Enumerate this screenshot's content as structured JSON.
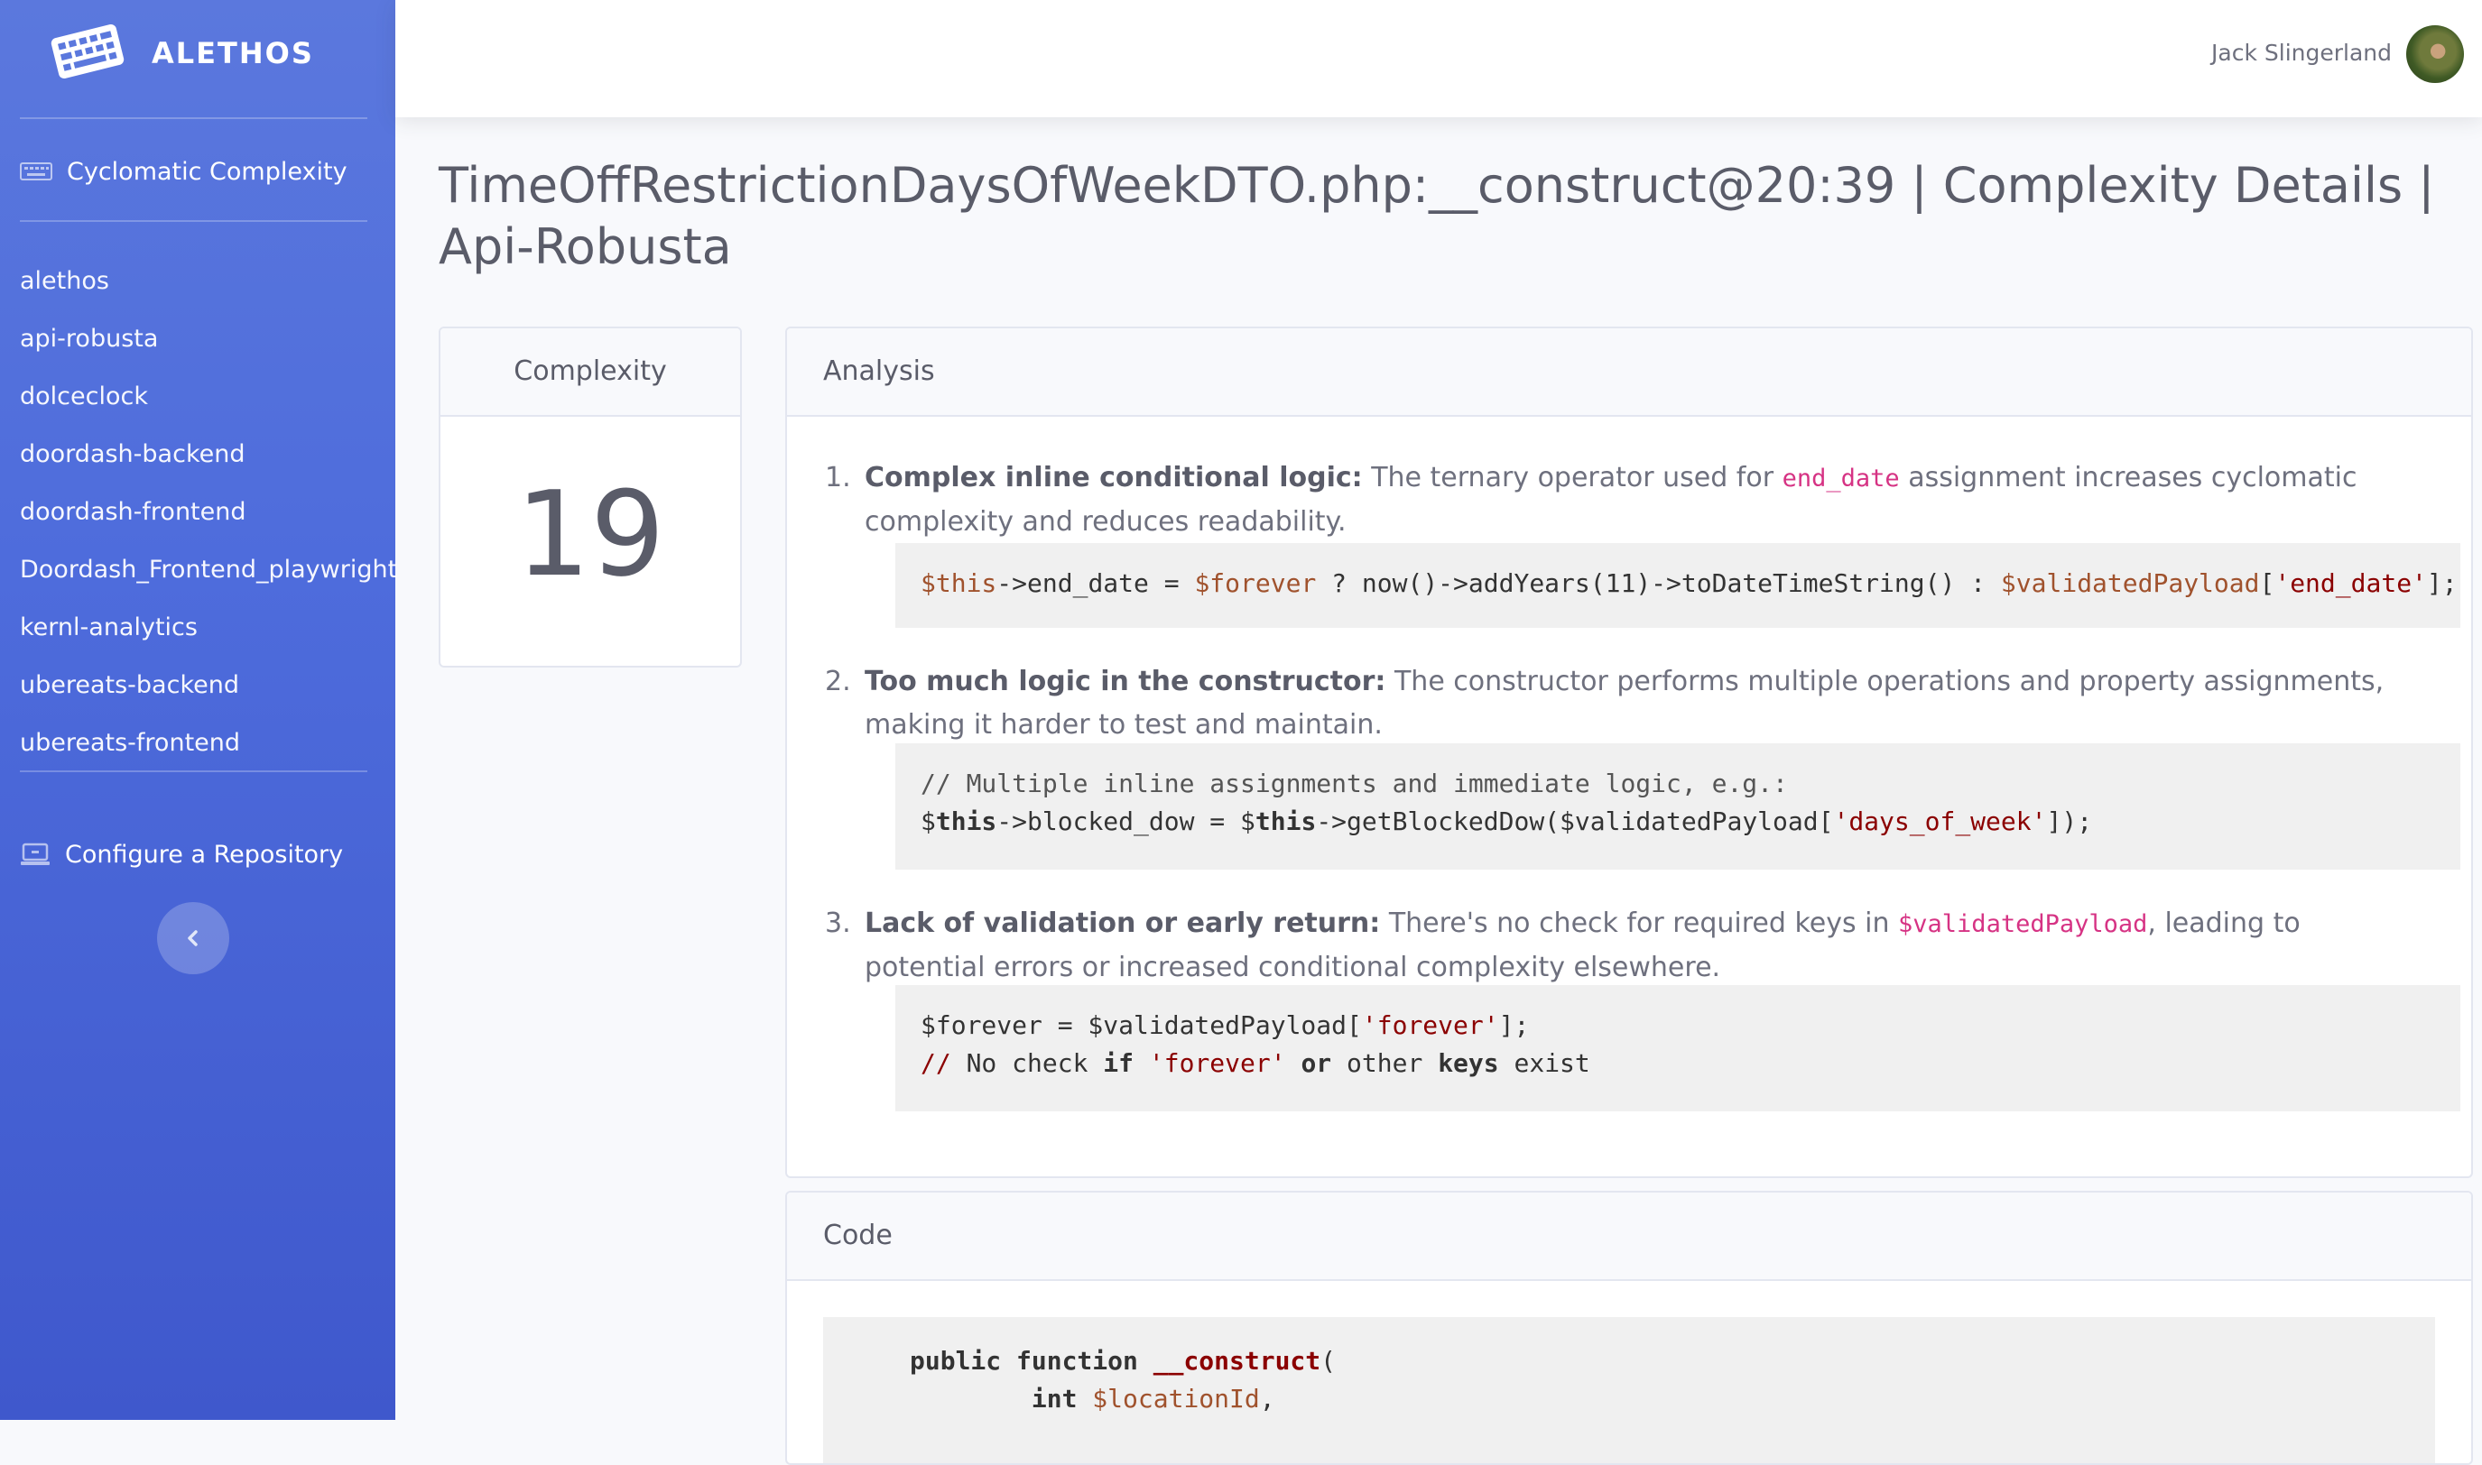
{
  "app": {
    "brand": "ALETHOS"
  },
  "sidebar": {
    "heading": "Cyclomatic Complexity",
    "repos": [
      "alethos",
      "api-robusta",
      "dolceclock",
      "doordash-backend",
      "doordash-frontend",
      "Doordash_Frontend_playwright",
      "kernl-analytics",
      "ubereats-backend",
      "ubereats-frontend"
    ],
    "configure_label": "Configure a Repository",
    "icons": {
      "heading": "keyboard-icon",
      "configure": "laptop-icon",
      "toggle": "chevron-left-icon"
    }
  },
  "topbar": {
    "user_name": "Jack Slingerland"
  },
  "page": {
    "title": "TimeOffRestrictionDaysOfWeekDTO.php:__construct@20:39 | Complexity Details | Api-Robusta"
  },
  "complexity": {
    "header": "Complexity",
    "value": "19"
  },
  "analysis": {
    "header": "Analysis",
    "items": [
      {
        "num": "1.",
        "title": "Complex inline conditional logic:",
        "text_a": " The ternary operator used for ",
        "code": "end_date",
        "text_b": " assignment increases cyclomatic complexity and reduces readability."
      },
      {
        "num": "2.",
        "title": "Too much logic in the constructor:",
        "text_a": " The constructor performs multiple operations and property assignments, making it harder to test and maintain."
      },
      {
        "num": "3.",
        "title": "Lack of validation or early return:",
        "text_a": " There's no check for required keys in ",
        "code": "$validatedPayload",
        "text_b": ", leading to potential errors or increased conditional complexity elsewhere."
      }
    ],
    "snippets": {
      "s1": {
        "t1": "$this",
        "t2": "->end_date = ",
        "t3": "$forever",
        "t4": " ? now()->addYears(11)->toDateTimeString() : ",
        "t5": "$validatedPayload",
        "t6": "[",
        "t7": "'end_date'",
        "t8": "];"
      },
      "s2": {
        "l1": "// Multiple inline assignments and immediate logic, e.g.:",
        "t1": "$",
        "t2": "this",
        "t3": "->blocked_dow = $",
        "t4": "this",
        "t5": "->getBlockedDow($validatedPayload[",
        "t6": "'days_of_week'",
        "t7": "]);"
      },
      "s3": {
        "l1": "$forever = $validatedPayload[",
        "s1": "'forever'",
        "l1b": "];",
        "c1": "//",
        "c2": " No check ",
        "k1": "if",
        "sp": " ",
        "s2": "'forever'",
        "sp2": " ",
        "k2": "or",
        "c3": " other ",
        "k3": "keys",
        "c4": " exist"
      }
    }
  },
  "code": {
    "header": "Code",
    "line1": {
      "a": "public function ",
      "b": "__construct",
      "c": "("
    },
    "line2": {
      "a": "int ",
      "b": "$locationId",
      ",": ","
    }
  }
}
